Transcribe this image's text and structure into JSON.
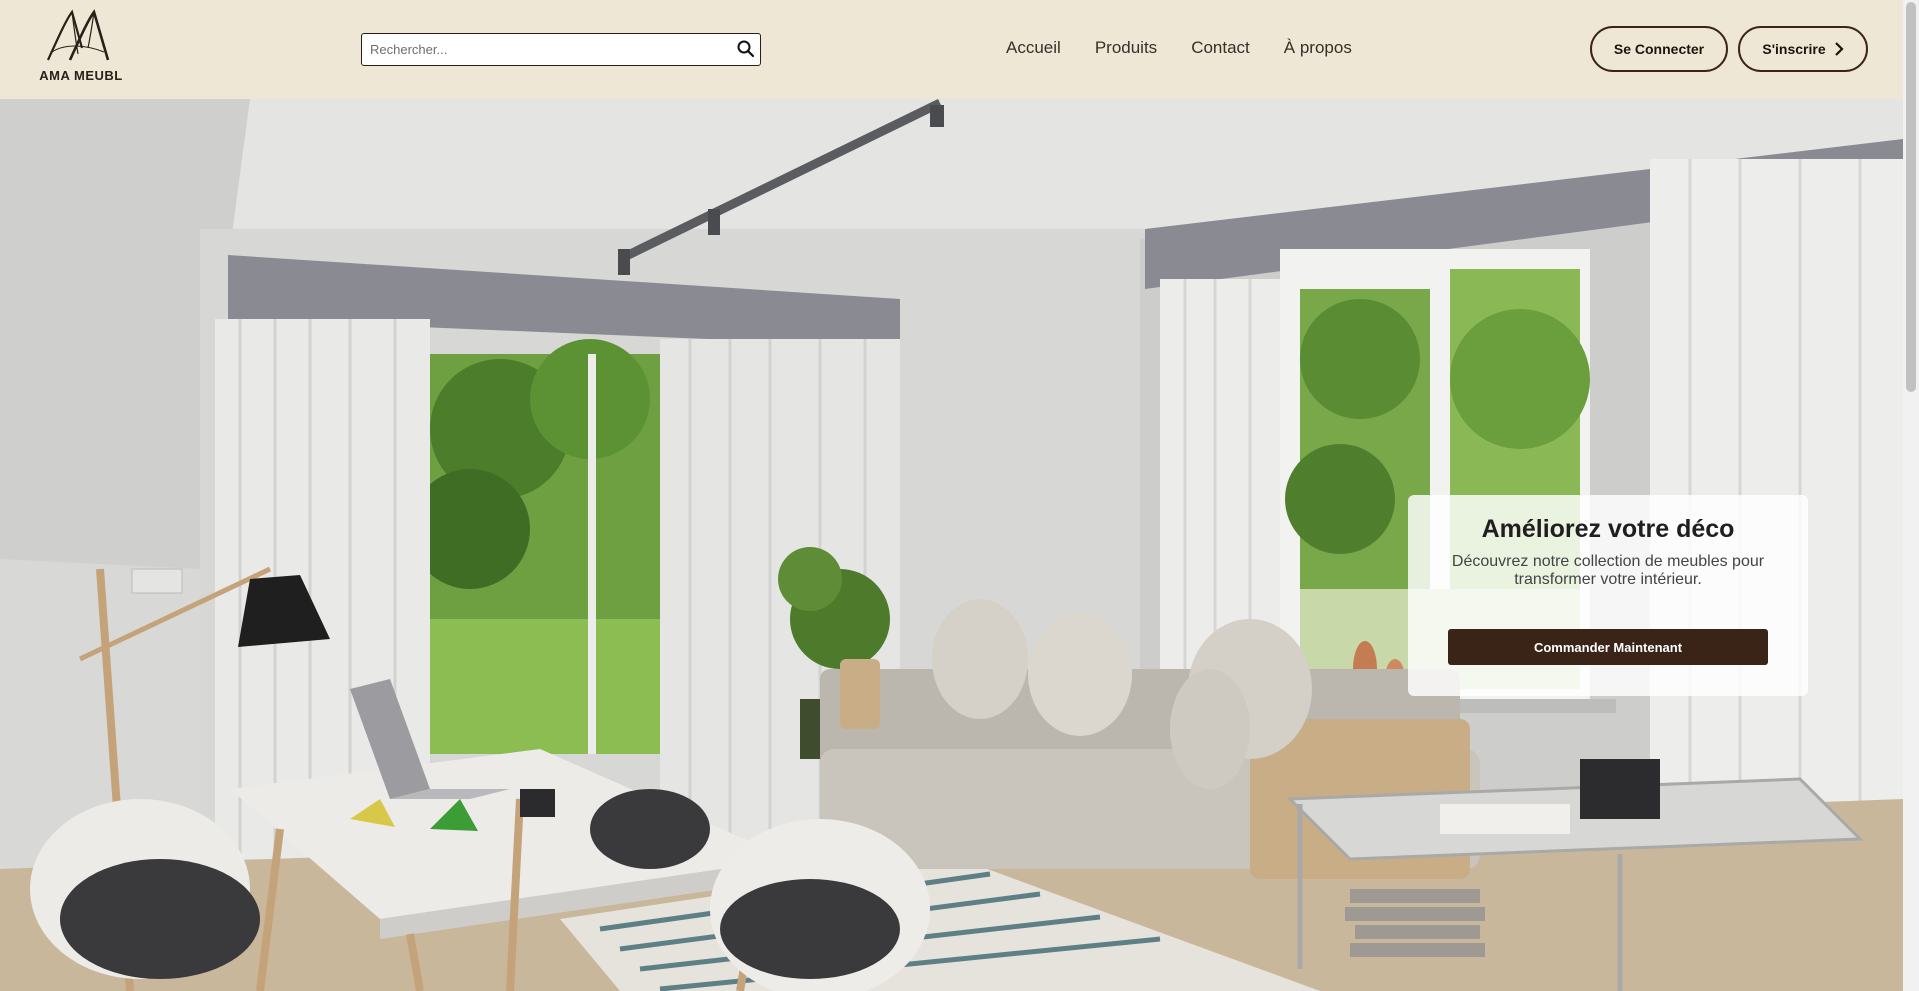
{
  "brand": {
    "name": "AMA MEUBL"
  },
  "search": {
    "placeholder": "Rechercher..."
  },
  "nav": {
    "items": [
      {
        "label": "Accueil"
      },
      {
        "label": "Produits"
      },
      {
        "label": "Contact"
      },
      {
        "label": "À propos"
      }
    ]
  },
  "auth": {
    "login_label": "Se Connecter",
    "signup_label": "S'inscrire"
  },
  "hero": {
    "promo_title": "Améliorez votre déco",
    "promo_text": "Découvrez notre collection de meubles pour transformer votre intérieur.",
    "cta_label": "Commander Maintenant"
  },
  "colors": {
    "header_bg": "#efe7d6",
    "accent_dark": "#3a2418",
    "text_dark": "#2b2019"
  },
  "icons": {
    "search": "search-icon",
    "signup_chevron": "chevron-right-icon"
  }
}
